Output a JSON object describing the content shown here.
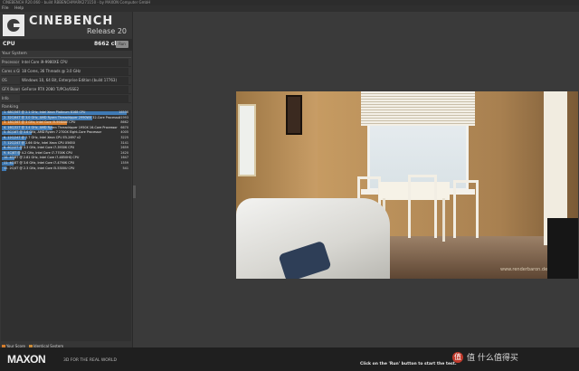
{
  "window": {
    "title": "CINEBENCH R20.060 - build RBBENCHMARK271150 - by MAXON Computer GmbH"
  },
  "menu": {
    "items": [
      "File",
      "Help"
    ]
  },
  "header": {
    "brand": "CINEBENCH",
    "release": "Release 20"
  },
  "cpu": {
    "label": "CPU",
    "score": "8662 cb",
    "run_label": "Run"
  },
  "system": {
    "title": "Your System",
    "rows": [
      {
        "key": "Processor",
        "value": "Intel Core i9-9980XE CPU"
      },
      {
        "key": "Cores x GHz",
        "value": "18 Cores, 36 Threads @ 3.0 GHz"
      },
      {
        "key": "OS",
        "value": "Windows 10, 64 Bit, Enterprise Edition (build 17763)"
      },
      {
        "key": "GFX Board",
        "value": "GeForce RTX 2080 Ti/PCIe/SSE2"
      },
      {
        "key": "Info",
        "value": ""
      }
    ]
  },
  "ranking": {
    "title": "Ranking",
    "rows": [
      {
        "name": "1. 68C/56T @ 2.1 GHz, Intel Xeon Platinum 8168 CPU",
        "score": "16536",
        "fraction": 1.0,
        "mine": false
      },
      {
        "name": "2. 32C/64T @ 3.0 GHz, AMD Ryzen Threadripper 2990WX 32-Core Processor",
        "score": "11993",
        "fraction": 0.725,
        "mine": false
      },
      {
        "name": "3. 18C/36T @ 3 GHz, Intel Core i9-9980XE CPU",
        "score": "8662",
        "fraction": 0.524,
        "mine": true
      },
      {
        "name": "4. 16C/32T @ 3.4 GHz, AMD Ryzen Threadripper 1950X 16-Core Processor",
        "score": "6670",
        "fraction": 0.403,
        "mine": false
      },
      {
        "name": "5. 8C/16T @ 3.6 GHz, AMD Ryzen 7 2700X Eight-Core Processor",
        "score": "4005",
        "fraction": 0.242,
        "mine": false
      },
      {
        "name": "6. 12C/24T @ 2.7 GHz, Intel Xeon CPU E5-2697 v2",
        "score": "3225",
        "fraction": 0.195,
        "mine": false
      },
      {
        "name": "7. 12C/24T @ 2.66 GHz, Intel Xeon CPU X5650",
        "score": "3141",
        "fraction": 0.19,
        "mine": false
      },
      {
        "name": "8. 6C/12T @ 3.3 GHz, Intel Core i7-3930K CPU",
        "score": "2659",
        "fraction": 0.161,
        "mine": false
      },
      {
        "name": "9. 4C/8T @ 4.2 GHz, Intel Core i7-7700K CPU",
        "score": "2420",
        "fraction": 0.146,
        "mine": false
      },
      {
        "name": "10. 4C/8T @ 2.81 GHz, Intel Core i7-4850HQ CPU",
        "score": "1647",
        "fraction": 0.1,
        "mine": false
      },
      {
        "name": "11. 4C/8T @ 3.6 GHz, Intel Core i7-4790K CPU",
        "score": "1559",
        "fraction": 0.094,
        "mine": false
      },
      {
        "name": "12. 2C/4T @ 2.3 GHz, Intel Core i5-5300U CPU",
        "score": "541",
        "fraction": 0.033,
        "mine": false
      }
    ]
  },
  "legend": {
    "your_score": "Your Score",
    "identical": "Identical System"
  },
  "footer": {
    "brand": "MAXON",
    "tagline": "3D FOR THE REAL WORLD",
    "hint": "Click on the 'Run' button to start the test.",
    "watermark": "值 什么值得买"
  },
  "render": {
    "watermark": "www.renderbaron.de"
  },
  "colors": {
    "bar": "#3f7ab4",
    "mine": "#d47c2c",
    "identical": "#c98b3a"
  }
}
